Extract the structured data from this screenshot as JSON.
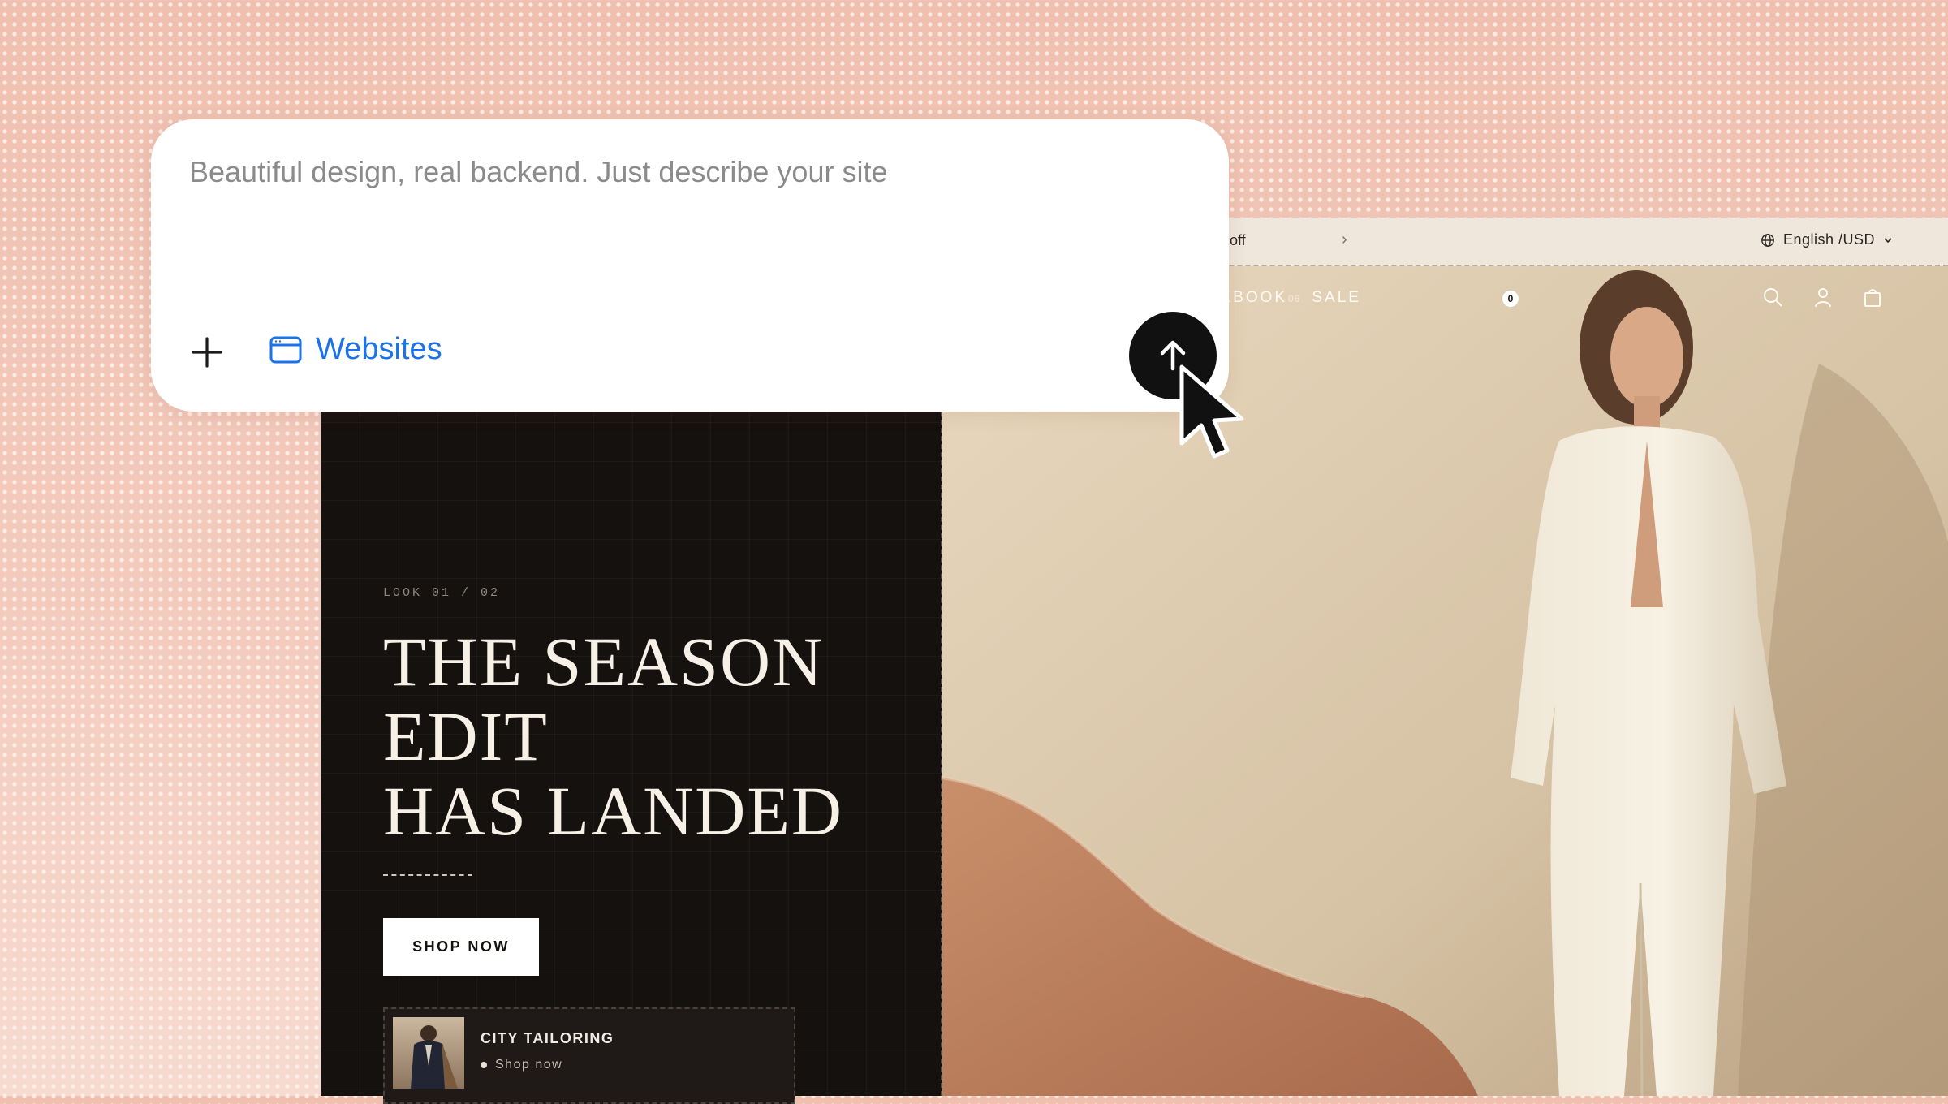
{
  "prompt": {
    "placeholder": "Beautiful design, real backend. Just describe your site",
    "chip_label": "Websites",
    "add_icon": "plus-icon",
    "chip_icon": "browser-window-icon",
    "send_icon": "arrow-up-icon",
    "accent_color": "#1a73e8"
  },
  "store": {
    "announcement": {
      "text": "off",
      "chevron": "›"
    },
    "locale": {
      "label": "English /USD",
      "icon": "globe-icon"
    },
    "nav": {
      "items": [
        {
          "num": "05",
          "label": "LOOKBOOK"
        },
        {
          "num": "06",
          "label": "SALE"
        }
      ],
      "cart_count": "0"
    },
    "hero": {
      "look_label": "LOOK 01 / 02",
      "title_lines": [
        "THE SEASON",
        "EDIT",
        "HAS LANDED"
      ],
      "cta": "SHOP NOW"
    },
    "promo": {
      "title": "CITY TAILORING",
      "sub": "Shop now"
    }
  }
}
